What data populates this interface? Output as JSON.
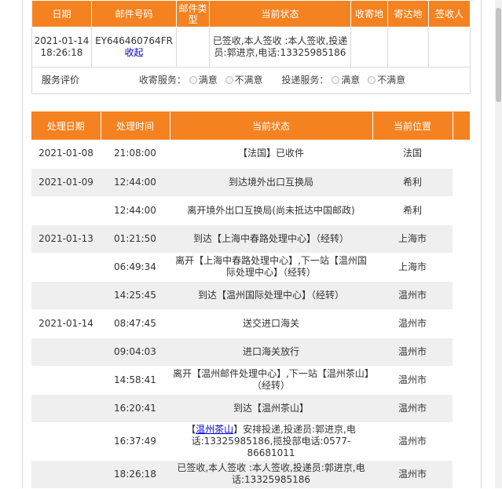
{
  "summary": {
    "headers": [
      "日期",
      "邮件号码",
      "邮件类型",
      "当前状态",
      "收寄地",
      "寄达地",
      "签收人"
    ],
    "row": {
      "date": "2021-01-14 18:26:18",
      "tracking_number": "EY646460764FR",
      "collapse_label": "收起",
      "mail_type": "",
      "status": "已签收,本人签收 :本人签收,投递员:郭进京,电话:13325985186",
      "origin": "",
      "destination": "",
      "signer": ""
    },
    "rating": {
      "label": "服务评价",
      "receive_label": "收寄服务：",
      "deliver_label": "投递服务：",
      "satisfied": "满意",
      "unsatisfied": "不满意"
    }
  },
  "events": {
    "headers": [
      "处理日期",
      "处理时间",
      "当前状态",
      "当前位置"
    ],
    "rows": [
      {
        "date": "2021-01-08",
        "time": "21:08:00",
        "status": "【法国】已收件",
        "location": "法国",
        "h": 36
      },
      {
        "date": "2021-01-09",
        "time": "12:44:00",
        "status": "到达境外出口互换局",
        "location": "希利",
        "h": 36
      },
      {
        "date": "",
        "time": "12:44:00",
        "status": "离开境外出口互换局(尚未抵达中国邮政)",
        "location": "希利",
        "h": 36
      },
      {
        "date": "2021-01-13",
        "time": "01:21:50",
        "status": "到达【上海中春路处理中心】（经转）",
        "location": "上海市",
        "h": 36
      },
      {
        "date": "",
        "time": "06:49:34",
        "status": "离开【上海中春路处理中心】,下一站【温州国际处理中心】（经转）",
        "location": "上海市",
        "h": 36
      },
      {
        "date": "",
        "time": "14:25:45",
        "status": "到达【温州国际处理中心】（经转）",
        "location": "温州市",
        "h": 36
      },
      {
        "date": "2021-01-14",
        "time": "08:47:45",
        "status": "送交进口海关",
        "location": "温州市",
        "h": 36
      },
      {
        "date": "",
        "time": "09:04:03",
        "status": "进口海关放行",
        "location": "温州市",
        "h": 36
      },
      {
        "date": "",
        "time": "14:58:41",
        "status": "离开【温州邮件处理中心】,下一站【温州茶山】（经转）",
        "location": "温州市",
        "h": 36
      },
      {
        "date": "",
        "time": "16:20:41",
        "status": "到达【温州茶山】",
        "location": "温州市",
        "h": 36
      },
      {
        "date": "",
        "time": "16:37:49",
        "status_prefix": "【",
        "status_link": "温州茶山",
        "status": "】安排投递,投递员:郭进京,电话:13325985186,揽投部电话:0577-86681011",
        "location": "温州市",
        "h": 48
      },
      {
        "date": "",
        "time": "18:26:18",
        "status": "已签收,本人签收 :本人签收,投递员:郭进京,电话:13325985186",
        "location": "温州市",
        "h": 36
      }
    ]
  }
}
